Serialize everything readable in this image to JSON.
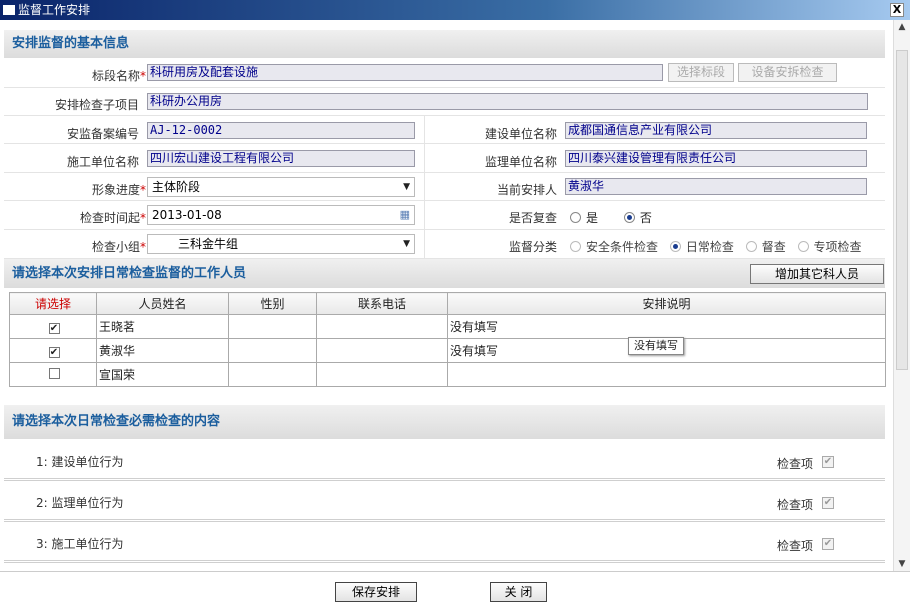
{
  "window": {
    "title": "监督工作安排",
    "close_label": "X"
  },
  "section1": {
    "title": "安排监督的基本信息"
  },
  "form": {
    "bidsection_label": "标段名称",
    "bidsection_value": "科研用房及配套设施",
    "select_bid_btn": "选择标段",
    "device_check_btn": "设备安拆检查",
    "subproject_label": "安排检查子项目",
    "subproject_value": "科研办公用房",
    "record_no_label": "安监备案编号",
    "record_no_value": "AJ-12-0002",
    "builder_label": "建设单位名称",
    "builder_value": "成都国通信息产业有限公司",
    "constructor_label": "施工单位名称",
    "constructor_value": "四川宏山建设工程有限公司",
    "supervisor_label": "监理单位名称",
    "supervisor_value": "四川泰兴建设管理有限责任公司",
    "progress_label": "形象进度",
    "progress_value": "主体阶段",
    "arranger_label": "当前安排人",
    "arranger_value": "黄淑华",
    "time_label": "检查时间起",
    "time_value": "2013-01-08",
    "recheck_label": "是否复查",
    "recheck_yes": "是",
    "recheck_no": "否",
    "group_label": "检查小组",
    "group_value": "三科金牛组",
    "category_label": "监督分类",
    "category_opt1": "安全条件检查",
    "category_opt2": "日常检查",
    "category_opt3": "督查",
    "category_opt4": "专项检查"
  },
  "section2": {
    "title": "请选择本次安排日常检查监督的工作人员",
    "add_btn": "增加其它科人员"
  },
  "people_table": {
    "headers": [
      "请选择",
      "人员姓名",
      "性别",
      "联系电话",
      "安排说明"
    ],
    "rows": [
      {
        "checked": true,
        "name": "王晓茗",
        "gender": "",
        "phone": "",
        "note": "没有填写"
      },
      {
        "checked": true,
        "name": "黄淑华",
        "gender": "",
        "phone": "",
        "note": "没有填写"
      },
      {
        "checked": false,
        "name": "宣国荣",
        "gender": "",
        "phone": "",
        "note": ""
      }
    ]
  },
  "tooltip": "没有填写",
  "section3": {
    "title": "请选择本次日常检查必需检查的内容"
  },
  "check_items": [
    {
      "index": "1:",
      "name": "建设单位行为",
      "tag": "检查项"
    },
    {
      "index": "2:",
      "name": "监理单位行为",
      "tag": "检查项"
    },
    {
      "index": "3:",
      "name": "施工单位行为",
      "tag": "检查项"
    }
  ],
  "footer": {
    "save_btn": "保存安排",
    "close_btn": "关 闭"
  }
}
